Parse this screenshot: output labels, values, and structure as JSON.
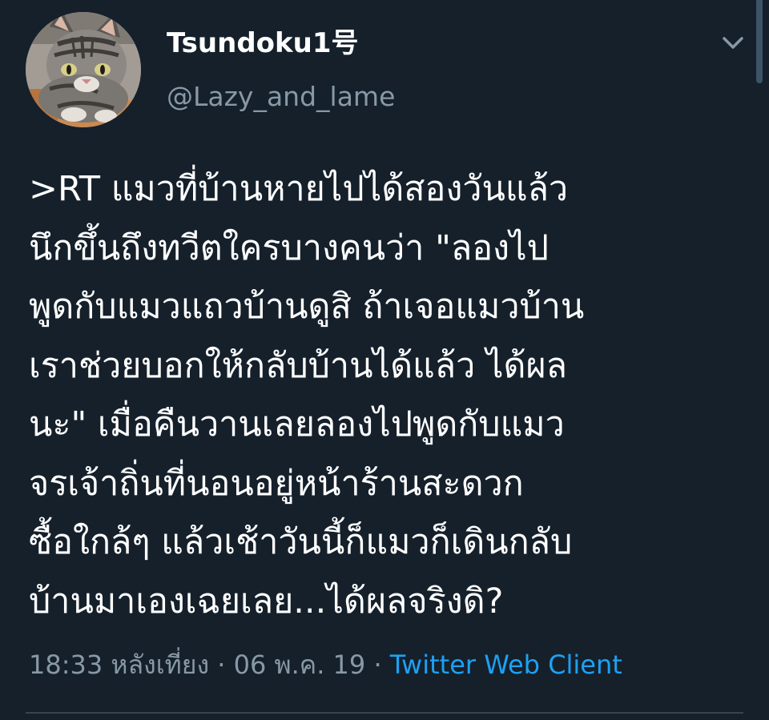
{
  "tweet": {
    "author": {
      "display_name": "Tsundoku1号",
      "handle": "@Lazy_and_lame",
      "avatar_icon": "cat-photo-avatar"
    },
    "menu_icon": "chevron-down-icon",
    "text_lines": [
      ">RT แมวที่บ้านหายไปได้สองวันแล้ว",
      "นึกขึ้นถึงทวีตใครบางคนว่า \"ลองไป",
      "พูดกับแมวแถวบ้านดูสิ ถ้าเจอแมวบ้าน",
      "เราช่วยบอกให้กลับบ้านได้แล้ว ได้ผล",
      "นะ\" เมื่อคืนวานเลยลองไปพูดกับแมว",
      "จรเจ้าถิ่นที่นอนอยู่หน้าร้านสะดวก",
      "ซื้อใกล้ๆ แล้วเช้าวันนี้ก็แมวก็เดินกลับ",
      "บ้านมาเองเฉยเลย...ได้ผลจริงดิ?"
    ],
    "time": "18:33 หลังเที่ยง",
    "separator": "·",
    "date": "06 พ.ค. 19",
    "client": "Twitter Web Client"
  },
  "colors": {
    "background": "#15202b",
    "primary_text": "#ffffff",
    "secondary_text": "#8899a6",
    "link": "#1da1f2",
    "divider": "#38444d"
  }
}
